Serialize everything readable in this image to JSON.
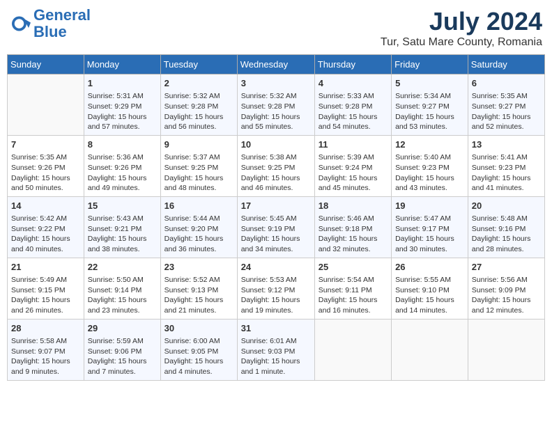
{
  "header": {
    "logo_line1": "General",
    "logo_line2": "Blue",
    "month": "July 2024",
    "location": "Tur, Satu Mare County, Romania"
  },
  "days_of_week": [
    "Sunday",
    "Monday",
    "Tuesday",
    "Wednesday",
    "Thursday",
    "Friday",
    "Saturday"
  ],
  "weeks": [
    [
      {
        "day": "",
        "info": ""
      },
      {
        "day": "1",
        "info": "Sunrise: 5:31 AM\nSunset: 9:29 PM\nDaylight: 15 hours\nand 57 minutes."
      },
      {
        "day": "2",
        "info": "Sunrise: 5:32 AM\nSunset: 9:28 PM\nDaylight: 15 hours\nand 56 minutes."
      },
      {
        "day": "3",
        "info": "Sunrise: 5:32 AM\nSunset: 9:28 PM\nDaylight: 15 hours\nand 55 minutes."
      },
      {
        "day": "4",
        "info": "Sunrise: 5:33 AM\nSunset: 9:28 PM\nDaylight: 15 hours\nand 54 minutes."
      },
      {
        "day": "5",
        "info": "Sunrise: 5:34 AM\nSunset: 9:27 PM\nDaylight: 15 hours\nand 53 minutes."
      },
      {
        "day": "6",
        "info": "Sunrise: 5:35 AM\nSunset: 9:27 PM\nDaylight: 15 hours\nand 52 minutes."
      }
    ],
    [
      {
        "day": "7",
        "info": "Sunrise: 5:35 AM\nSunset: 9:26 PM\nDaylight: 15 hours\nand 50 minutes."
      },
      {
        "day": "8",
        "info": "Sunrise: 5:36 AM\nSunset: 9:26 PM\nDaylight: 15 hours\nand 49 minutes."
      },
      {
        "day": "9",
        "info": "Sunrise: 5:37 AM\nSunset: 9:25 PM\nDaylight: 15 hours\nand 48 minutes."
      },
      {
        "day": "10",
        "info": "Sunrise: 5:38 AM\nSunset: 9:25 PM\nDaylight: 15 hours\nand 46 minutes."
      },
      {
        "day": "11",
        "info": "Sunrise: 5:39 AM\nSunset: 9:24 PM\nDaylight: 15 hours\nand 45 minutes."
      },
      {
        "day": "12",
        "info": "Sunrise: 5:40 AM\nSunset: 9:23 PM\nDaylight: 15 hours\nand 43 minutes."
      },
      {
        "day": "13",
        "info": "Sunrise: 5:41 AM\nSunset: 9:23 PM\nDaylight: 15 hours\nand 41 minutes."
      }
    ],
    [
      {
        "day": "14",
        "info": "Sunrise: 5:42 AM\nSunset: 9:22 PM\nDaylight: 15 hours\nand 40 minutes."
      },
      {
        "day": "15",
        "info": "Sunrise: 5:43 AM\nSunset: 9:21 PM\nDaylight: 15 hours\nand 38 minutes."
      },
      {
        "day": "16",
        "info": "Sunrise: 5:44 AM\nSunset: 9:20 PM\nDaylight: 15 hours\nand 36 minutes."
      },
      {
        "day": "17",
        "info": "Sunrise: 5:45 AM\nSunset: 9:19 PM\nDaylight: 15 hours\nand 34 minutes."
      },
      {
        "day": "18",
        "info": "Sunrise: 5:46 AM\nSunset: 9:18 PM\nDaylight: 15 hours\nand 32 minutes."
      },
      {
        "day": "19",
        "info": "Sunrise: 5:47 AM\nSunset: 9:17 PM\nDaylight: 15 hours\nand 30 minutes."
      },
      {
        "day": "20",
        "info": "Sunrise: 5:48 AM\nSunset: 9:16 PM\nDaylight: 15 hours\nand 28 minutes."
      }
    ],
    [
      {
        "day": "21",
        "info": "Sunrise: 5:49 AM\nSunset: 9:15 PM\nDaylight: 15 hours\nand 26 minutes."
      },
      {
        "day": "22",
        "info": "Sunrise: 5:50 AM\nSunset: 9:14 PM\nDaylight: 15 hours\nand 23 minutes."
      },
      {
        "day": "23",
        "info": "Sunrise: 5:52 AM\nSunset: 9:13 PM\nDaylight: 15 hours\nand 21 minutes."
      },
      {
        "day": "24",
        "info": "Sunrise: 5:53 AM\nSunset: 9:12 PM\nDaylight: 15 hours\nand 19 minutes."
      },
      {
        "day": "25",
        "info": "Sunrise: 5:54 AM\nSunset: 9:11 PM\nDaylight: 15 hours\nand 16 minutes."
      },
      {
        "day": "26",
        "info": "Sunrise: 5:55 AM\nSunset: 9:10 PM\nDaylight: 15 hours\nand 14 minutes."
      },
      {
        "day": "27",
        "info": "Sunrise: 5:56 AM\nSunset: 9:09 PM\nDaylight: 15 hours\nand 12 minutes."
      }
    ],
    [
      {
        "day": "28",
        "info": "Sunrise: 5:58 AM\nSunset: 9:07 PM\nDaylight: 15 hours\nand 9 minutes."
      },
      {
        "day": "29",
        "info": "Sunrise: 5:59 AM\nSunset: 9:06 PM\nDaylight: 15 hours\nand 7 minutes."
      },
      {
        "day": "30",
        "info": "Sunrise: 6:00 AM\nSunset: 9:05 PM\nDaylight: 15 hours\nand 4 minutes."
      },
      {
        "day": "31",
        "info": "Sunrise: 6:01 AM\nSunset: 9:03 PM\nDaylight: 15 hours\nand 1 minute."
      },
      {
        "day": "",
        "info": ""
      },
      {
        "day": "",
        "info": ""
      },
      {
        "day": "",
        "info": ""
      }
    ]
  ]
}
